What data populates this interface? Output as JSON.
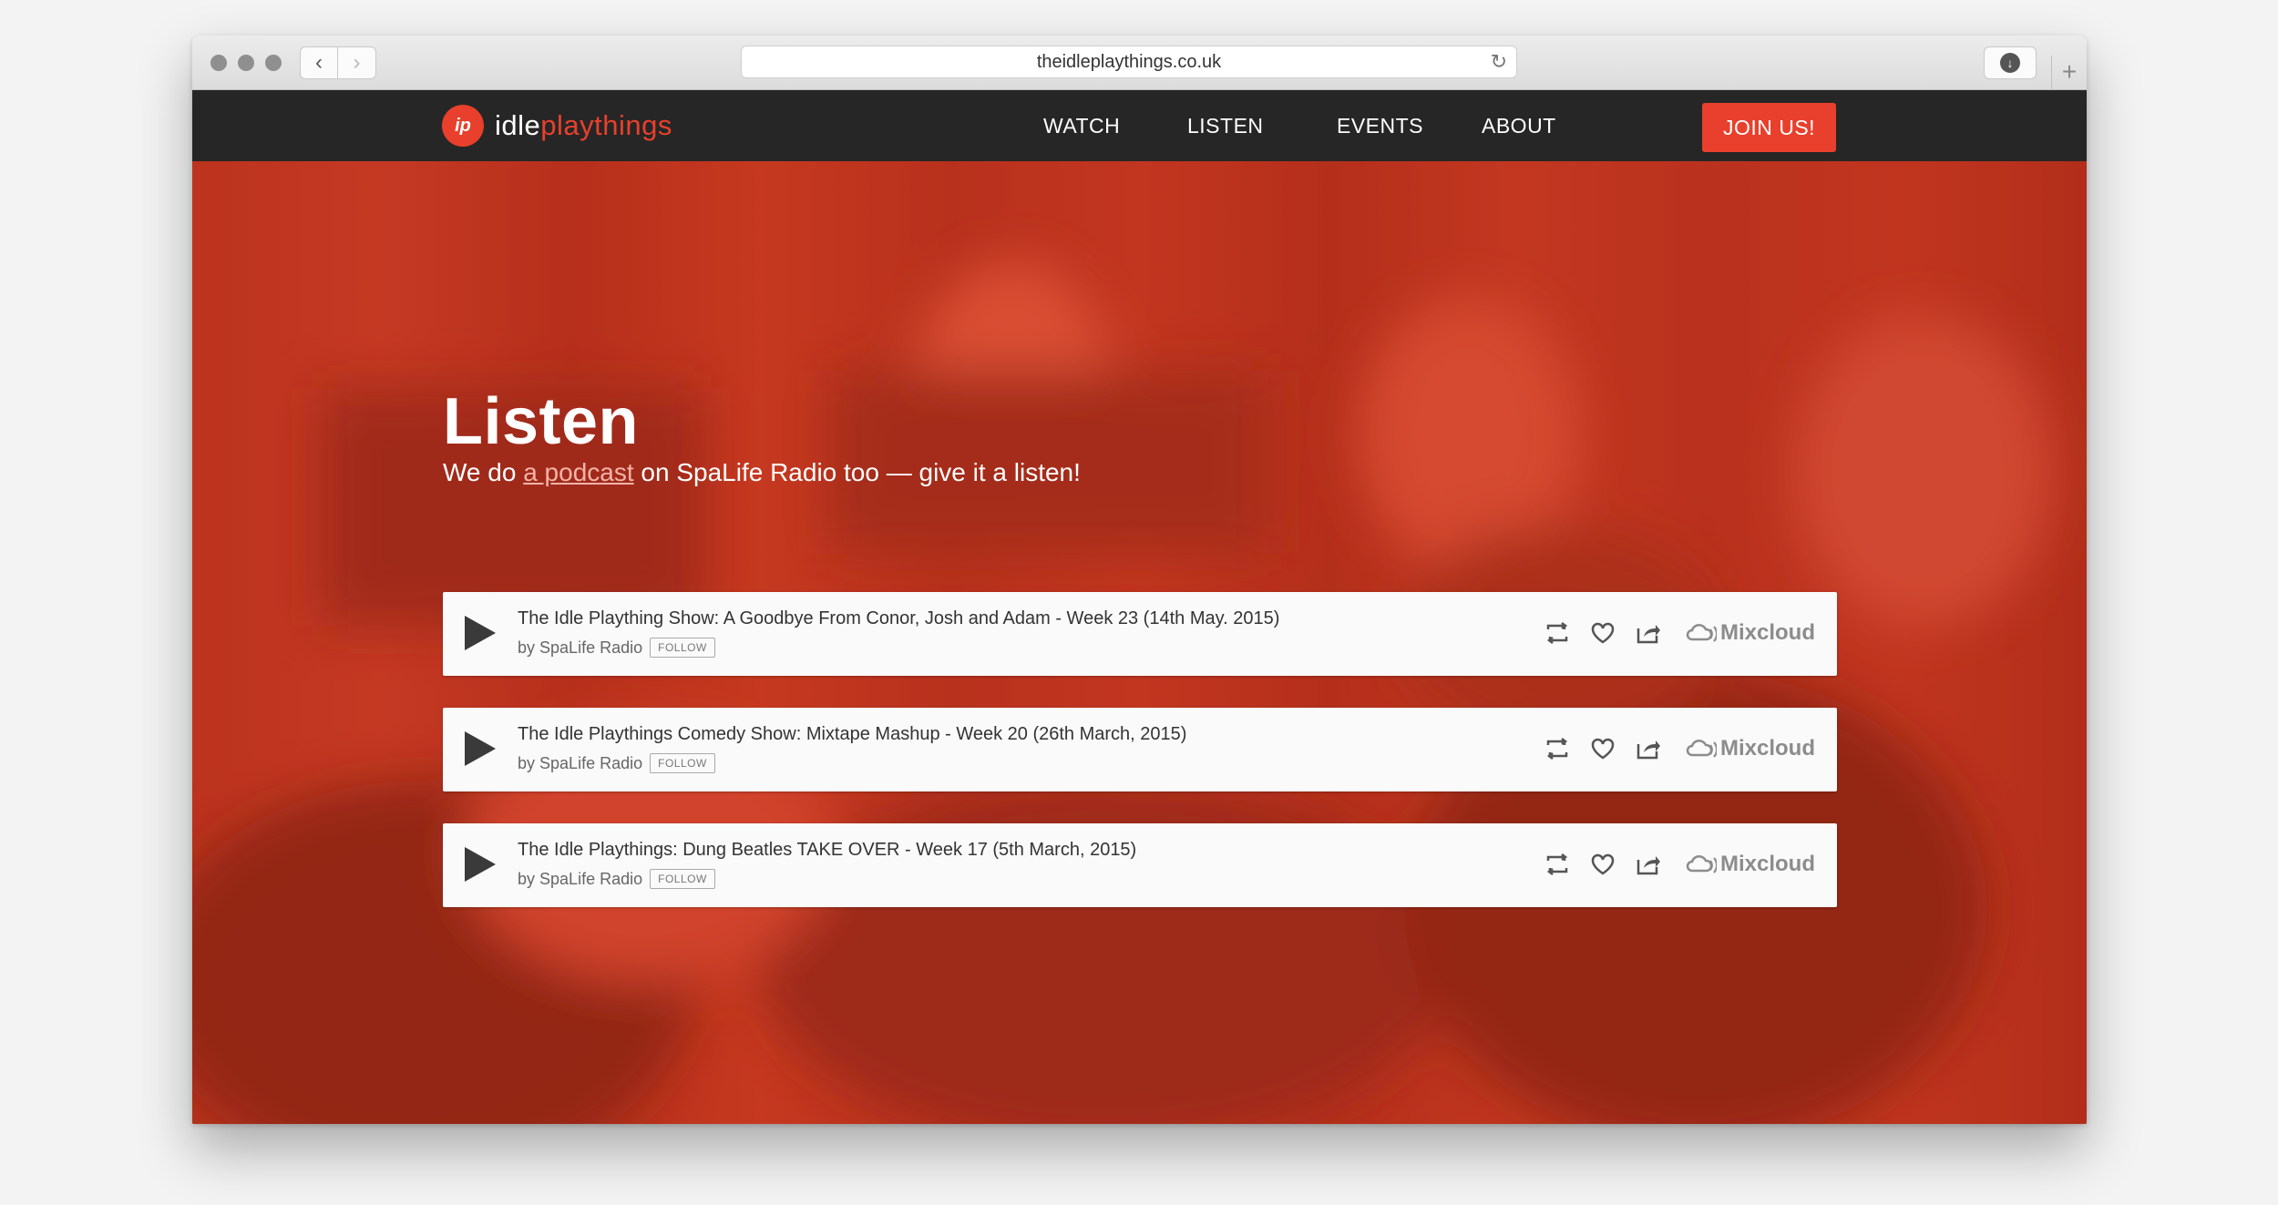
{
  "browser": {
    "url": "theidleplaythings.co.uk"
  },
  "site": {
    "logo_mark": "ip",
    "logo_text_plain": "idle",
    "logo_text_accent": "playthings",
    "nav": [
      "WATCH",
      "LISTEN",
      "EVENTS",
      "ABOUT"
    ],
    "cta": "JOIN US!"
  },
  "hero": {
    "title": "Listen",
    "subtitle_pre": "We do ",
    "subtitle_link": "a podcast",
    "subtitle_post": " on SpaLife Radio too — give it a listen!"
  },
  "players": [
    {
      "title": "The Idle Plaything Show: A Goodbye From Conor, Josh and Adam - Week 23 (14th May. 2015)",
      "by": "by",
      "author": "SpaLife Radio",
      "follow": "FOLLOW",
      "brand": "Mixcloud"
    },
    {
      "title": "The Idle Playthings Comedy Show: Mixtape Mashup - Week 20 (26th March, 2015)",
      "by": "by",
      "author": "SpaLife Radio",
      "follow": "FOLLOW",
      "brand": "Mixcloud"
    },
    {
      "title": "The Idle Playthings: Dung Beatles TAKE OVER - Week 17 (5th March, 2015)",
      "by": "by",
      "author": "SpaLife Radio",
      "follow": "FOLLOW",
      "brand": "Mixcloud"
    }
  ],
  "colors": {
    "accent": "#e8402c",
    "nav_bg": "#262626",
    "hero_tint": "#c0311d"
  }
}
